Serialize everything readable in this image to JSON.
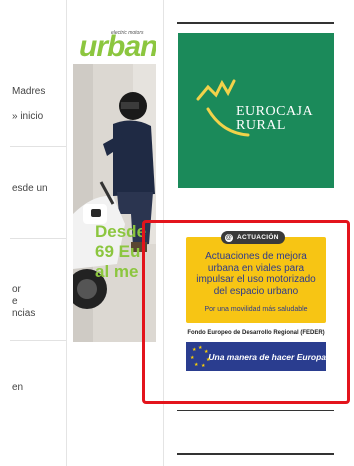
{
  "left_column": {
    "items": [
      {
        "line1": "Madres",
        "line2": "» inicio"
      },
      {
        "line1": "esde un"
      },
      {
        "line1": "or",
        "line2": "e",
        "line3": "ncias"
      },
      {
        "line1": "en"
      }
    ]
  },
  "urban_ad": {
    "logo": "urban",
    "tagline": "electric motors",
    "promo_line1": "Desde",
    "promo_line2": "69 Eu",
    "promo_line3": "al me"
  },
  "eurocaja_ad": {
    "line1": "EUROCAJA",
    "line2": "RURAL",
    "brand_color": "#1b8a5a"
  },
  "actuacion_ad": {
    "badge": "ACTUACIÓN",
    "headline_line1": "Actuaciones de mejora",
    "headline_line2": "urbana en viales para",
    "headline_line3": "impulsar el uso motorizado",
    "headline_line4": "del espacio urbano",
    "subline": "Por una movilidad más saludable",
    "feder": "Fondo Europeo de Desarrollo Regional (FEDER)",
    "eu_slogan": "Una manera de hacer Europa",
    "box_color": "#f7c514",
    "highlight_color": "#e3141c"
  }
}
